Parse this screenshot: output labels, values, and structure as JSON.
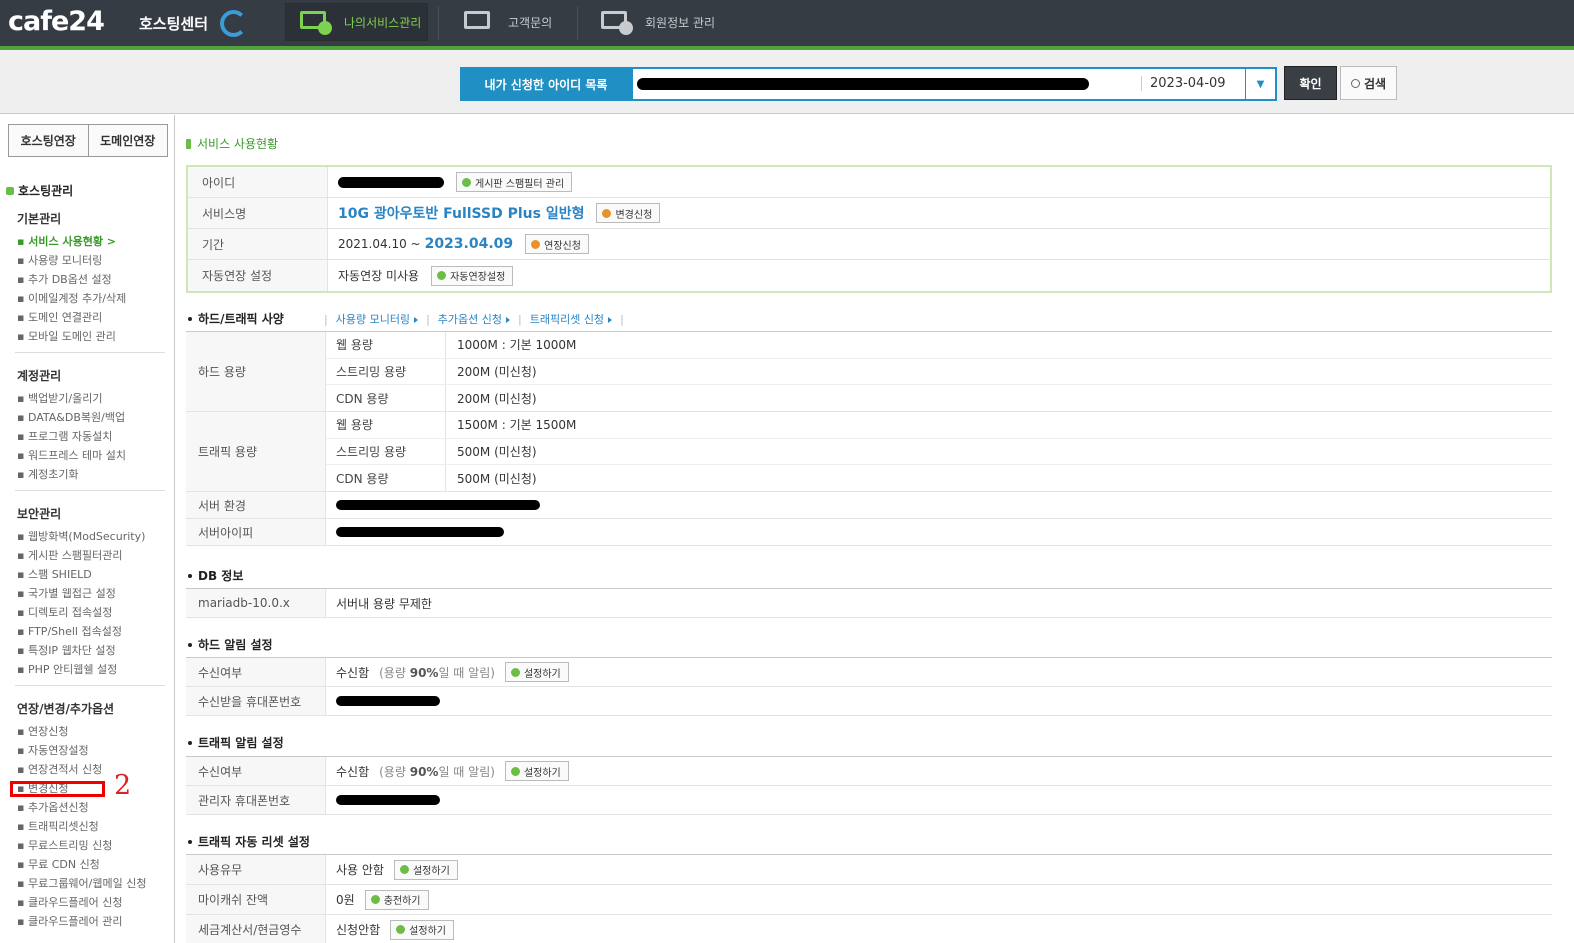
{
  "header": {
    "logo": "cafe24",
    "logo_sub": "호스팅센터",
    "nav": [
      {
        "label": "나의서비스관리"
      },
      {
        "label": "고객문의"
      },
      {
        "label": "회원정보 관리"
      }
    ]
  },
  "search": {
    "id_list_label": "내가 신청한 아이디 목록",
    "selected_date": "2023-04-09",
    "confirm_label": "확인",
    "search_label": "검색"
  },
  "sidebar": {
    "extend_buttons": [
      "호스팅연장",
      "도메인연장"
    ],
    "title": "호스팅관리",
    "groups": [
      {
        "label": "기본관리",
        "items": [
          "서비스 사용현황 >",
          "사용량 모니터링",
          "추가 DB옵션 설정",
          "이메일계정 추가/삭제",
          "도메인 연결관리",
          "모바일 도메인 관리"
        ]
      },
      {
        "label": "계정관리",
        "items": [
          "백업받기/올리기",
          "DATA&DB복원/백업",
          "프로그램 자동설치",
          "워드프레스 테마 설치",
          "계정초기화"
        ]
      },
      {
        "label": "보안관리",
        "items": [
          "웹방화벽(ModSecurity)",
          "게시판 스팸필터관리",
          "스팸 SHIELD",
          "국가별 웹접근 설정",
          "디렉토리 접속설정",
          "FTP/Shell 접속설정",
          "특정IP 웹차단 설정",
          "PHP 안티웹쉘 설정"
        ]
      },
      {
        "label": "연장/변경/추가옵션",
        "items": [
          "연장신청",
          "자동연장설정",
          "연장견적서 신청",
          "변경신청",
          "추가옵션신청",
          "트래픽리셋신청",
          "무료스트리밍 신청",
          "무료 CDN 신청",
          "무료그룹웨어/웹메일 신청",
          "클라우드플레어 신청",
          "클라우드플레어 관리"
        ]
      }
    ],
    "annotation_number": "2"
  },
  "main": {
    "section_title": "서비스 사용현황",
    "summary": {
      "id_label": "아이디",
      "spam_btn": "게시판 스팸필터 관리",
      "service_label": "서비스명",
      "service_name": "10G 광아우토반 FullSSD Plus 일반형",
      "change_btn": "변경신청",
      "period_label": "기간",
      "period_start": "2021.04.10 ~",
      "period_end": "2023.04.09",
      "extend_btn": "연장신청",
      "auto_label": "자동연장 설정",
      "auto_value": "자동연장 미사용",
      "auto_btn": "자동연장설정"
    },
    "hw": {
      "title": "하드/트래픽 사양",
      "links": [
        "사용량 모니터링",
        "추가옵션 신청",
        "트래픽리셋 신청"
      ],
      "hard_label": "하드 용량",
      "hard_rows": [
        {
          "k": "웹 용량",
          "v": "1000M : 기본 1000M"
        },
        {
          "k": "스트리밍 용량",
          "v": "200M (미신청)"
        },
        {
          "k": "CDN 용량",
          "v": "200M (미신청)"
        }
      ],
      "traffic_label": "트래픽 용량",
      "traffic_rows": [
        {
          "k": "웹 용량",
          "v": "1500M : 기본 1500M"
        },
        {
          "k": "스트리밍 용량",
          "v": "500M (미신청)"
        },
        {
          "k": "CDN 용량",
          "v": "500M (미신청)"
        }
      ],
      "server_env_label": "서버 환경",
      "server_ip_label": "서버아이피"
    },
    "db": {
      "title": "DB 정보",
      "key": "mariadb-10.0.x",
      "value": "서버내 용량 무제한"
    },
    "hard_alert": {
      "title": "하드 알림 설정",
      "recv_label": "수신여부",
      "recv_value": "수신함",
      "recv_note_pre": "(용량",
      "recv_note_pct": "90%",
      "recv_note_post": "일 때 알림)",
      "btn": "설정하기",
      "phone_label": "수신받을 휴대폰번호"
    },
    "traffic_alert": {
      "title": "트래픽 알림 설정",
      "recv_label": "수신여부",
      "recv_value": "수신함",
      "recv_note_pre": "(용량",
      "recv_note_pct": "90%",
      "recv_note_post": "일 때 알림)",
      "btn": "설정하기",
      "phone_label": "관리자 휴대폰번호"
    },
    "traffic_reset": {
      "title": "트래픽 자동 리셋 설정",
      "use_label": "사용유무",
      "use_value": "사용 안함",
      "use_btn": "설정하기",
      "cash_label": "마이캐쉬 잔액",
      "cash_value": "0원",
      "cash_btn": "충전하기",
      "tax_label": "세금계산서/현금영수",
      "tax_value": "신청안함",
      "tax_btn": "설정하기"
    }
  },
  "colors": {
    "topbar": "#363c43",
    "accent_green": "#4fa33c",
    "accent_blue": "#1f8fc4",
    "annotation_red": "#e00000"
  }
}
